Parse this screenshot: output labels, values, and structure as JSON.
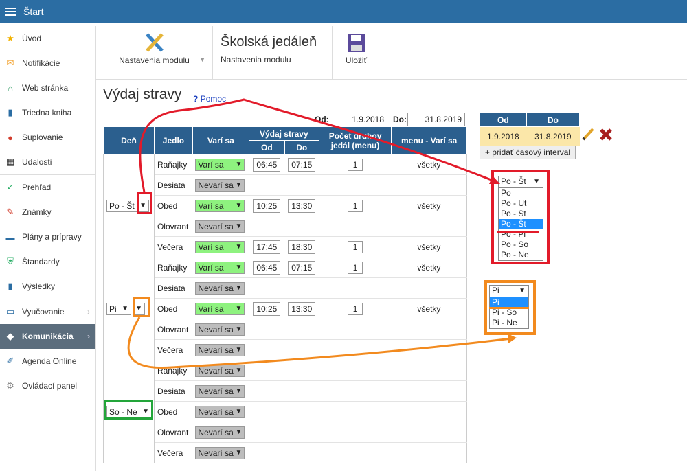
{
  "app": {
    "title": "Štart"
  },
  "sidebar": {
    "items": [
      {
        "label": "Úvod",
        "icon": "star-icon"
      },
      {
        "label": "Notifikácie",
        "icon": "envelope-icon"
      },
      {
        "label": "Web stránka",
        "icon": "home-icon"
      },
      {
        "label": "Triedna kniha",
        "icon": "book-icon"
      },
      {
        "label": "Suplovanie",
        "icon": "user-icon"
      },
      {
        "label": "Udalosti",
        "icon": "calendar-icon"
      },
      {
        "label": "Prehľad",
        "icon": "check-icon"
      },
      {
        "label": "Známky",
        "icon": "grade-icon"
      },
      {
        "label": "Plány a prípravy",
        "icon": "briefcase-icon"
      },
      {
        "label": "Štandardy",
        "icon": "shield-icon"
      },
      {
        "label": "Výsledky",
        "icon": "bar-chart-icon"
      },
      {
        "label": "Vyučovanie",
        "icon": "monitor-icon"
      },
      {
        "label": "Komunikácia",
        "icon": "chat-icon"
      },
      {
        "label": "Agenda Online",
        "icon": "pen-icon"
      },
      {
        "label": "Ovládací panel",
        "icon": "gear-icon"
      }
    ]
  },
  "toolbar": {
    "settings_label": "Nastavenia modulu",
    "module_title": "Školská jedáleň",
    "module_subtitle": "Nastavenia modulu",
    "save_label": "Uložiť"
  },
  "page": {
    "title": "Výdaj stravy",
    "help": "Pomoc",
    "help_mark": "?",
    "od_label": "Od:",
    "od_value": "1.9.2018",
    "do_label": "Do:",
    "do_value": "31.8.2019"
  },
  "table": {
    "headers": {
      "day": "Deň",
      "meal": "Jedlo",
      "cooks": "Varí sa",
      "issue": "Výdaj stravy",
      "issue_od": "Od",
      "issue_do": "Do",
      "count": "Počet druhov jedál (menu)",
      "menu": "menu - Varí sa"
    }
  },
  "groups": [
    {
      "day": "Po - Št",
      "rows": [
        {
          "meal": "Raňajky",
          "status": "Varí sa",
          "od": "06:45",
          "do": "07:15",
          "count": "1",
          "menu": "všetky"
        },
        {
          "meal": "Desiata",
          "status": "Nevarí sa"
        },
        {
          "meal": "Obed",
          "status": "Varí sa",
          "od": "10:25",
          "do": "13:30",
          "count": "1",
          "menu": "všetky"
        },
        {
          "meal": "Olovrant",
          "status": "Nevarí sa"
        },
        {
          "meal": "Večera",
          "status": "Varí sa",
          "od": "17:45",
          "do": "18:30",
          "count": "1",
          "menu": "všetky"
        }
      ]
    },
    {
      "day": "Pi",
      "rows": [
        {
          "meal": "Raňajky",
          "status": "Varí sa",
          "od": "06:45",
          "do": "07:15",
          "count": "1",
          "menu": "všetky"
        },
        {
          "meal": "Desiata",
          "status": "Nevarí sa"
        },
        {
          "meal": "Obed",
          "status": "Varí sa",
          "od": "10:25",
          "do": "13:30",
          "count": "1",
          "menu": "všetky"
        },
        {
          "meal": "Olovrant",
          "status": "Nevarí sa"
        },
        {
          "meal": "Večera",
          "status": "Nevarí sa"
        }
      ]
    },
    {
      "day": "So - Ne",
      "rows": [
        {
          "meal": "Raňajky",
          "status": "Nevarí sa"
        },
        {
          "meal": "Desiata",
          "status": "Nevarí sa"
        },
        {
          "meal": "Obed",
          "status": "Nevarí sa"
        },
        {
          "meal": "Olovrant",
          "status": "Nevarí sa"
        },
        {
          "meal": "Večera",
          "status": "Nevarí sa"
        }
      ]
    }
  ],
  "interval": {
    "headers": [
      "Od",
      "Do"
    ],
    "od": "1.9.2018",
    "do": "31.8.2019",
    "add_label": "+ pridať časový interval"
  },
  "dropdown1": {
    "selected": "Po - Št",
    "options": [
      "Po",
      "Po - Ut",
      "Po - St",
      "Po - Št",
      "Po - Pi",
      "Po - So",
      "Po - Ne"
    ],
    "highlight": 3
  },
  "dropdown2": {
    "selected": "Pi",
    "options": [
      "Pi",
      "Pi - So",
      "Pi - Ne"
    ],
    "highlight": 0
  },
  "colors": {
    "accent": "#2b6da3",
    "header": "#2b5f8e",
    "cooks": "#8ef27f",
    "not_cooks": "#bdbdbd",
    "red": "#e21b2a",
    "orange": "#f28a1e",
    "green": "#23a53a",
    "interval_bg": "#fbe7a9"
  }
}
